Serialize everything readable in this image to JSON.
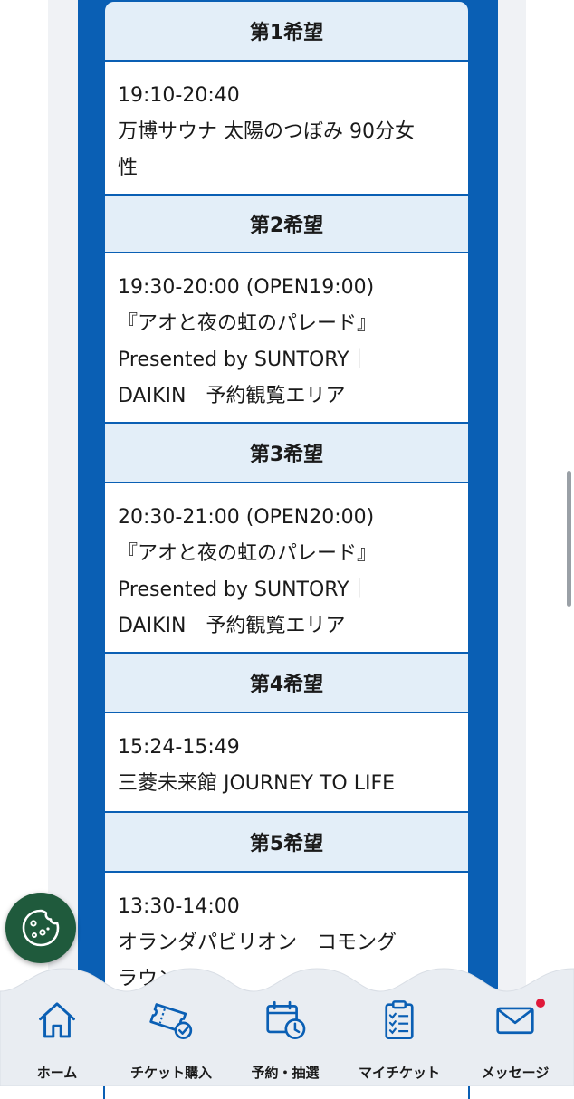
{
  "choices": [
    {
      "label": "第1希望",
      "lines": [
        "19:10-20:40",
        "万博サウナ 太陽のつぼみ 90分女",
        "性"
      ]
    },
    {
      "label": "第2希望",
      "lines": [
        "19:30-20:00 (OPEN19:00)",
        "『アオと夜の虹のパレード』",
        "Presented by SUNTORY｜",
        "DAIKIN　予約観覧エリア"
      ]
    },
    {
      "label": "第3希望",
      "lines": [
        "20:30-21:00 (OPEN20:00)",
        "『アオと夜の虹のパレード』",
        "Presented by SUNTORY｜",
        "DAIKIN　予約観覧エリア"
      ]
    },
    {
      "label": "第4希望",
      "lines": [
        "15:24-15:49",
        "三菱未来館 JOURNEY TO LIFE"
      ]
    },
    {
      "label": "第5希望",
      "lines": [
        "13:30-14:00",
        "オランダパビリオン　コモング",
        "ラウンド"
      ]
    }
  ],
  "nav": {
    "items": [
      {
        "label": "ホーム",
        "icon": "home-icon"
      },
      {
        "label": "チケット購入",
        "icon": "ticket-check-icon"
      },
      {
        "label": "予約・抽選",
        "icon": "calendar-clock-icon"
      },
      {
        "label": "マイチケット",
        "icon": "clipboard-list-icon"
      },
      {
        "label": "メッセージ",
        "icon": "envelope-icon"
      }
    ]
  },
  "colors": {
    "frame_blue": "#0a5fb4",
    "header_bg": "#e3eef8",
    "nav_bg": "#e9edf2",
    "cookie_green": "#1f5a3c",
    "badge_red": "#e0193a"
  }
}
